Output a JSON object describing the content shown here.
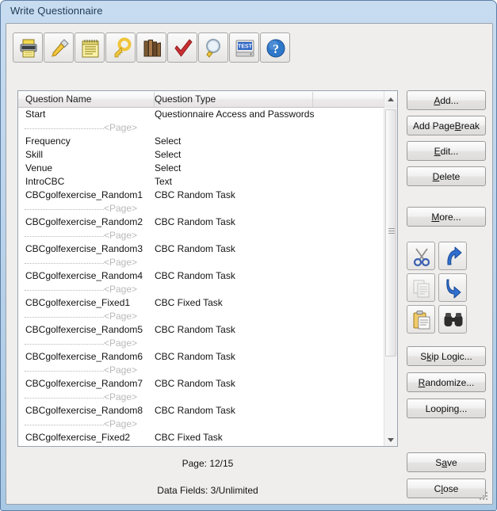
{
  "window": {
    "title": "Write Questionnaire"
  },
  "toolbar": {
    "buttons": [
      {
        "name": "print-icon",
        "label": "Print"
      },
      {
        "name": "screwdriver-icon",
        "label": "Settings"
      },
      {
        "name": "notepad-icon",
        "label": "Notes"
      },
      {
        "name": "key-icon",
        "label": "Passwords"
      },
      {
        "name": "books-icon",
        "label": "Library"
      },
      {
        "name": "checkmark-icon",
        "label": "Test Questionnaire"
      },
      {
        "name": "magnifier-icon",
        "label": "Preview"
      },
      {
        "name": "test-monitor-icon",
        "label": "Test Survey"
      },
      {
        "name": "help-icon",
        "label": "Help"
      }
    ]
  },
  "list": {
    "columns": [
      "Question Name",
      "Question Type"
    ],
    "page_break_label": "<Page>",
    "rows": [
      {
        "type": "item",
        "name": "Start",
        "qtype": "Questionnaire Access and Passwords"
      },
      {
        "type": "page"
      },
      {
        "type": "item",
        "name": "Frequency",
        "qtype": "Select"
      },
      {
        "type": "item",
        "name": "Skill",
        "qtype": "Select"
      },
      {
        "type": "item",
        "name": "Venue",
        "qtype": "Select"
      },
      {
        "type": "item",
        "name": "IntroCBC",
        "qtype": "Text"
      },
      {
        "type": "item",
        "name": "CBCgolfexercise_Random1",
        "qtype": "CBC Random Task"
      },
      {
        "type": "page"
      },
      {
        "type": "item",
        "name": "CBCgolfexercise_Random2",
        "qtype": "CBC Random Task"
      },
      {
        "type": "page"
      },
      {
        "type": "item",
        "name": "CBCgolfexercise_Random3",
        "qtype": "CBC Random Task"
      },
      {
        "type": "page"
      },
      {
        "type": "item",
        "name": "CBCgolfexercise_Random4",
        "qtype": "CBC Random Task"
      },
      {
        "type": "page"
      },
      {
        "type": "item",
        "name": "CBCgolfexercise_Fixed1",
        "qtype": "CBC Fixed Task"
      },
      {
        "type": "page"
      },
      {
        "type": "item",
        "name": "CBCgolfexercise_Random5",
        "qtype": "CBC Random Task"
      },
      {
        "type": "page"
      },
      {
        "type": "item",
        "name": "CBCgolfexercise_Random6",
        "qtype": "CBC Random Task"
      },
      {
        "type": "page"
      },
      {
        "type": "item",
        "name": "CBCgolfexercise_Random7",
        "qtype": "CBC Random Task"
      },
      {
        "type": "page"
      },
      {
        "type": "item",
        "name": "CBCgolfexercise_Random8",
        "qtype": "CBC Random Task"
      },
      {
        "type": "page"
      },
      {
        "type": "item",
        "name": "CBCgolfexercise_Fixed2",
        "qtype": "CBC Fixed Task"
      }
    ]
  },
  "side_buttons": {
    "add": {
      "pre": "",
      "accel": "A",
      "post": "dd..."
    },
    "add_page_break": {
      "pre": "Add Page ",
      "accel": "B",
      "post": "reak"
    },
    "edit": {
      "pre": "",
      "accel": "E",
      "post": "dit..."
    },
    "delete": {
      "pre": "",
      "accel": "D",
      "post": "elete"
    },
    "more": {
      "pre": "",
      "accel": "M",
      "post": "ore..."
    },
    "skip_logic": {
      "pre": "S",
      "accel": "k",
      "post": "ip Logic..."
    },
    "randomize": {
      "pre": "",
      "accel": "R",
      "post": "andomize..."
    },
    "looping": {
      "pre": "Loopin",
      "accel": "g",
      "post": "..."
    },
    "save": {
      "pre": "S",
      "accel": "a",
      "post": "ve"
    },
    "close": {
      "pre": "C",
      "accel": "l",
      "post": "ose"
    }
  },
  "icon_buttons": [
    {
      "name": "cut-icon",
      "label": "Cut",
      "disabled": false
    },
    {
      "name": "move-up-icon",
      "label": "Move Up",
      "disabled": false
    },
    {
      "name": "copy-icon",
      "label": "Copy",
      "disabled": true
    },
    {
      "name": "move-down-icon",
      "label": "Move Down",
      "disabled": false
    },
    {
      "name": "paste-icon",
      "label": "Paste",
      "disabled": false
    },
    {
      "name": "find-icon",
      "label": "Find",
      "disabled": false
    }
  ],
  "status": {
    "page": "Page: 12/15",
    "data_fields": "Data Fields: 3/Unlimited"
  },
  "colors": {
    "window_frame": "#a8c8e4",
    "client_bg": "#efeeec",
    "list_bg": "#ffffff",
    "page_break_text": "#b9b9b9",
    "title_text": "#1d3a56"
  }
}
